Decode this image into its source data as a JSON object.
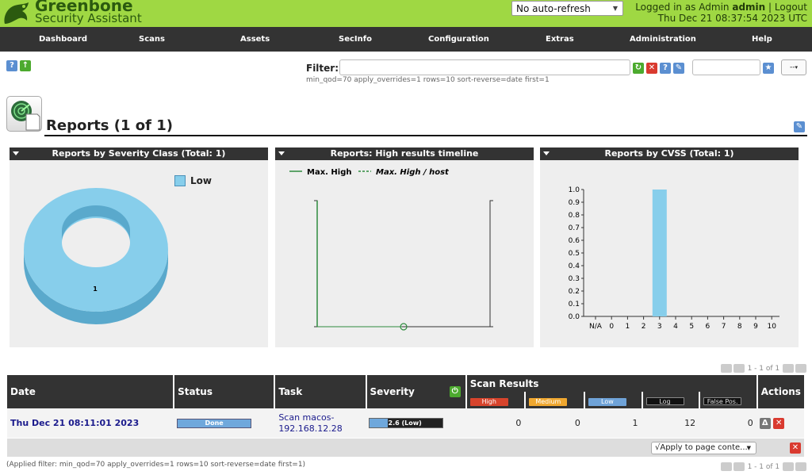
{
  "header": {
    "logo_line1": "Greenbone",
    "logo_line2": "Security Assistant",
    "refresh_selected": "No auto-refresh",
    "logged_in_as": "Logged in as",
    "role": "Admin",
    "username": "admin",
    "separator": "|",
    "logout": "Logout",
    "datetime": "Thu Dec 21 08:37:54 2023 UTC"
  },
  "nav": [
    "Dashboard",
    "Scans",
    "Assets",
    "SecInfo",
    "Configuration",
    "Extras",
    "Administration",
    "Help"
  ],
  "filter": {
    "label": "Filter:",
    "value": "",
    "text": "min_qod=70 apply_overrides=1 rows=10 sort-reverse=date first=1",
    "select": "--"
  },
  "page_title": "Reports (1 of 1)",
  "charts": {
    "severity": {
      "title": "Reports by Severity Class (Total: 1)",
      "legend": "Low",
      "label": "1",
      "color": "#87ceeb"
    },
    "timeline": {
      "title": "Reports: High results timeline",
      "legend1": "Max. High",
      "legend2": "Max. High / host"
    },
    "cvss": {
      "title": "Reports by CVSS (Total: 1)",
      "yticks": [
        "1.0",
        "0.9",
        "0.8",
        "0.7",
        "0.6",
        "0.5",
        "0.4",
        "0.3",
        "0.2",
        "0.1",
        "0.0"
      ],
      "xticks": [
        "N/A",
        "0",
        "1",
        "2",
        "3",
        "4",
        "5",
        "6",
        "7",
        "8",
        "9",
        "10"
      ],
      "bar_x_index": 4,
      "bar_value": 1.0
    }
  },
  "pagination": "1 - 1 of 1",
  "table": {
    "headers": {
      "date": "Date",
      "status": "Status",
      "task": "Task",
      "severity": "Severity",
      "scan_results": "Scan Results",
      "actions": "Actions"
    },
    "sr_labels": {
      "high": "High",
      "medium": "Medium",
      "low": "Low",
      "log": "Log",
      "false_pos": "False Pos."
    },
    "rows": [
      {
        "date": "Thu Dec 21 08:11:01 2023",
        "status": "Done",
        "task_line1": "Scan macos-",
        "task_line2": "192.168.12.28",
        "severity": "2.6 (Low)",
        "severity_fraction": 0.26,
        "high": "0",
        "medium": "0",
        "low": "1",
        "log": "12",
        "false_pos": "0"
      }
    ]
  },
  "apply_select": "√Apply to page conte...",
  "applied_filter": "(Applied filter: min_qod=70 apply_overrides=1 rows=10 sort-reverse=date first=1)"
}
